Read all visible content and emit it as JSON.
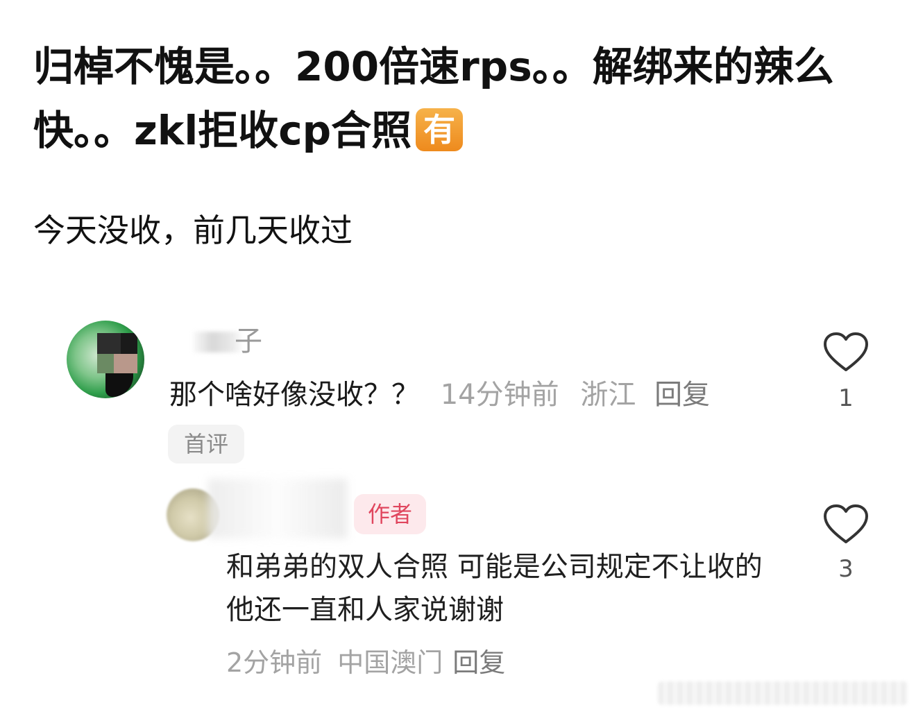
{
  "post": {
    "title": "归棹不愧是。。200倍速rps。。解绑来的辣么快。。zkl拒收cp合照",
    "badge": "有",
    "subtitle": "今天没收，前几天收过"
  },
  "comments": [
    {
      "username": "子",
      "text": "那个啥好像没收？？",
      "time": "14分钟前",
      "location": "浙江",
      "reply_label": "回复",
      "tag": "首评",
      "likes": "1"
    },
    {
      "author_tag": "作者",
      "text": "和弟弟的双人合照 可能是公司规定不让收的 他还一直和人家说谢谢",
      "time": "2分钟前",
      "location": "中国澳门",
      "reply_label": "回复",
      "likes": "3"
    }
  ],
  "icons": {
    "like": "heart-outline-icon",
    "badge_color": "#ee8a1d",
    "author_tag_color": "#e0465e"
  }
}
